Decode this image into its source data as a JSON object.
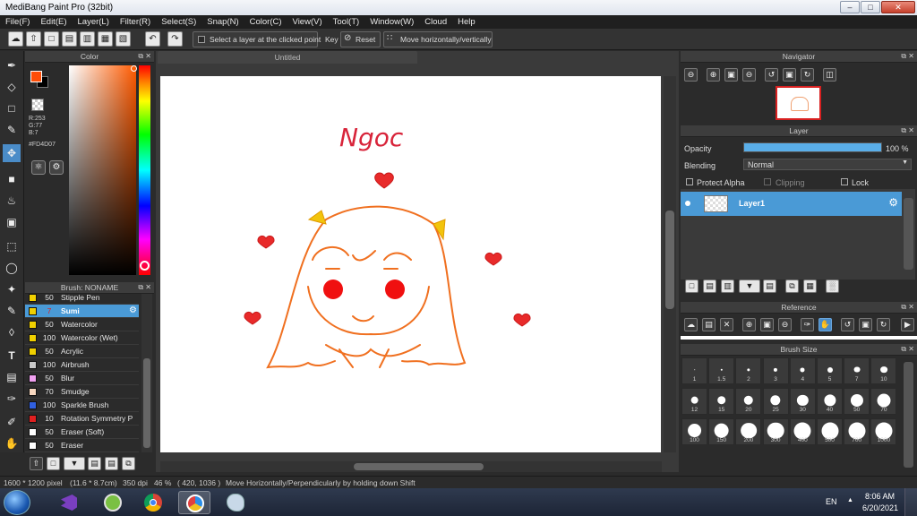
{
  "window": {
    "title": "MediBang Paint Pro (32bit)"
  },
  "menu": [
    "File(F)",
    "Edit(E)",
    "Layer(L)",
    "Filter(R)",
    "Select(S)",
    "Snap(N)",
    "Color(C)",
    "View(V)",
    "Tool(T)",
    "Window(W)",
    "Cloud",
    "Help"
  ],
  "toolbar": {
    "select_layer_label": "Select a layer at the clicked point",
    "key_label": "Key",
    "reset_label": "Reset",
    "move_label": "Move horizontally/vertically"
  },
  "color_panel": {
    "title": "Color",
    "r": "R:253",
    "g": "G:77",
    "b": "B:7",
    "hex": "#FD4D07",
    "foreground": "#fd4d07"
  },
  "brush_panel": {
    "title": "Brush: NONAME",
    "items": [
      {
        "size": "50",
        "name": "Stipple Pen",
        "color": "#f0d000"
      },
      {
        "size": "7",
        "name": "Sumi",
        "color": "#f0d000",
        "selected": true
      },
      {
        "size": "50",
        "name": "Watercolor",
        "color": "#f0d000"
      },
      {
        "size": "100",
        "name": "Watercolor (Wet)",
        "color": "#f0d000"
      },
      {
        "size": "50",
        "name": "Acrylic",
        "color": "#f0d000"
      },
      {
        "size": "100",
        "name": "Airbrush",
        "color": "#c8c8c8"
      },
      {
        "size": "50",
        "name": "Blur",
        "color": "#f0a0f0"
      },
      {
        "size": "70",
        "name": "Smudge",
        "color": "#f8d8c0"
      },
      {
        "size": "100",
        "name": "Sparkle Brush",
        "color": "#3060e0"
      },
      {
        "size": "10",
        "name": "Rotation Symmetry P",
        "color": "#e02020"
      },
      {
        "size": "50",
        "name": "Eraser (Soft)",
        "color": "#ffffff"
      },
      {
        "size": "50",
        "name": "Eraser",
        "color": "#ffffff"
      }
    ]
  },
  "document": {
    "tab_title": "Untitled",
    "drawing_text": "Ngoc"
  },
  "navigator": {
    "title": "Navigator"
  },
  "layer_panel": {
    "title": "Layer",
    "opacity_label": "Opacity",
    "opacity_value": "100 %",
    "opacity_fraction": 1.0,
    "blending_label": "Blending",
    "blending_value": "Normal",
    "protect_alpha": "Protect Alpha",
    "clipping": "Clipping",
    "lock": "Lock",
    "layer_name": "Layer1"
  },
  "reference": {
    "title": "Reference"
  },
  "brush_size": {
    "title": "Brush Size",
    "sizes": [
      "1",
      "1.5",
      "2",
      "3",
      "4",
      "5",
      "7",
      "10",
      "12",
      "15",
      "20",
      "25",
      "30",
      "40",
      "50",
      "70",
      "100",
      "150",
      "200",
      "300",
      "400",
      "500",
      "700",
      "1000"
    ]
  },
  "status": {
    "dimensions": "1600 * 1200 pixel",
    "physical": "(11.6 * 8.7cm)",
    "dpi": "350 dpi",
    "zoom": "46 %",
    "coords": "( 420, 1036 )",
    "hint": "Move Horizontally/Perpendicularly by holding down Shift"
  },
  "taskbar": {
    "lang": "EN",
    "time": "8:06 AM",
    "date": "6/20/2021"
  }
}
